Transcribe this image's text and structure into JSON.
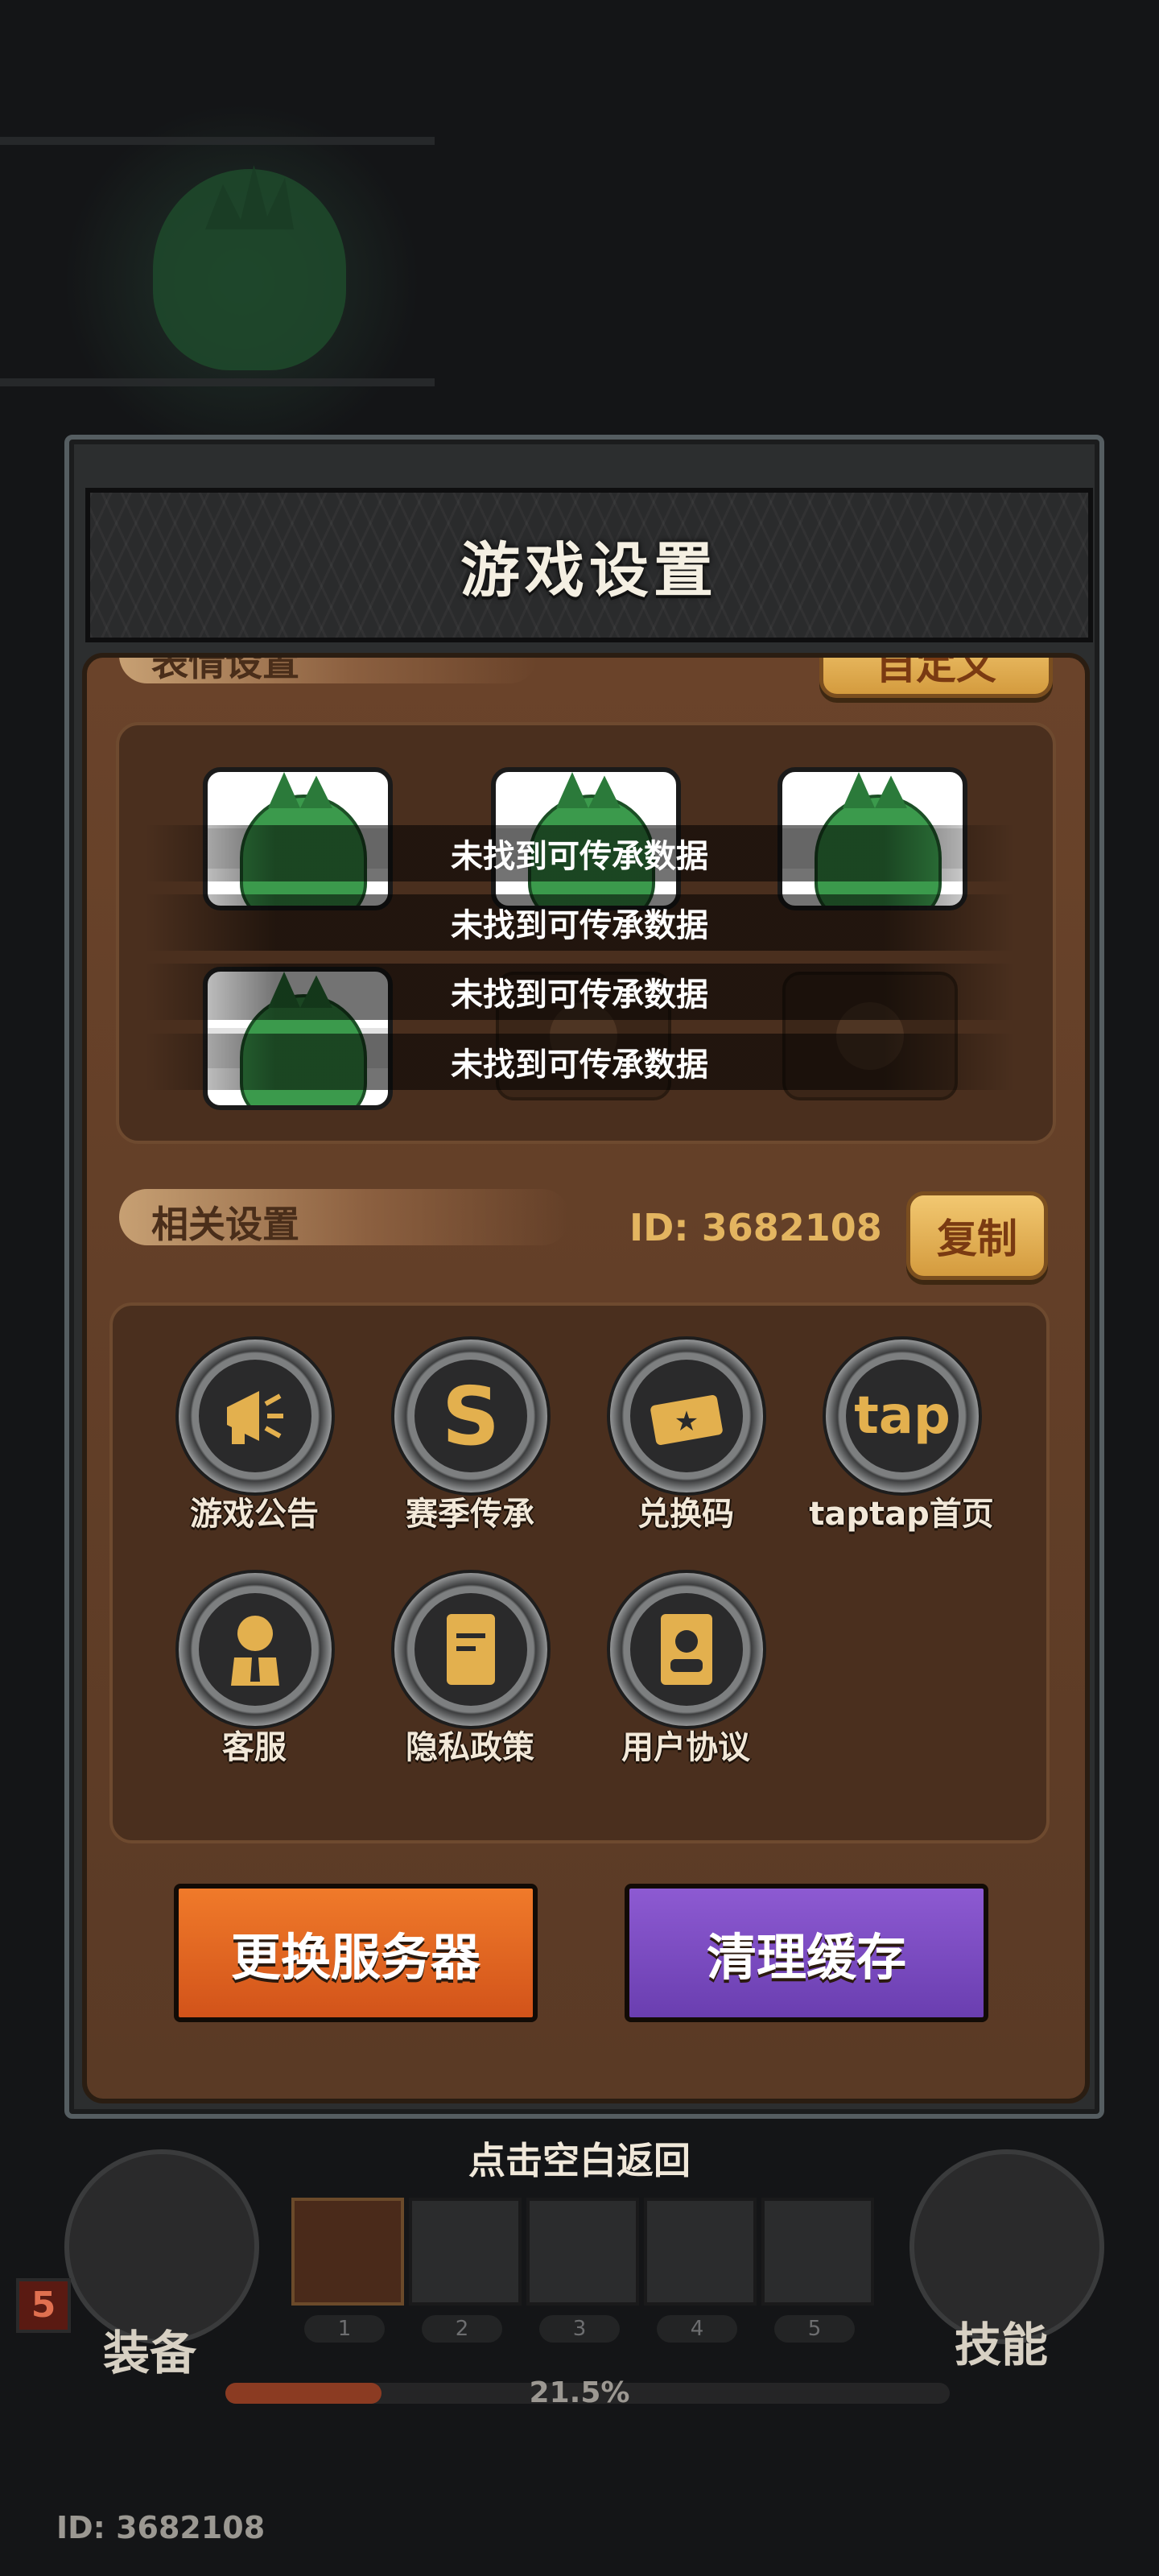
{
  "dialog": {
    "title": "游戏设置"
  },
  "expression_section": {
    "label": "表情设置",
    "custom_button": "自定义"
  },
  "toasts": [
    "未找到可传承数据",
    "未找到可传承数据",
    "未找到可传承数据",
    "未找到可传承数据"
  ],
  "related_section": {
    "label": "相关设置",
    "id_text": "ID: 3682108",
    "copy_button": "复制",
    "items": [
      {
        "label": "游戏公告",
        "icon": "megaphone-icon"
      },
      {
        "label": "赛季传承",
        "icon": "season-icon"
      },
      {
        "label": "兑换码",
        "icon": "ticket-icon"
      },
      {
        "label": "taptap首页",
        "icon": "taptap-icon",
        "glyph": "tap"
      },
      {
        "label": "客服",
        "icon": "customer-service-icon"
      },
      {
        "label": "隐私政策",
        "icon": "document-icon"
      },
      {
        "label": "用户协议",
        "icon": "id-card-icon"
      }
    ]
  },
  "buttons": {
    "change_server": "更换服务器",
    "clear_cache": "清理缓存"
  },
  "hud": {
    "hint": "点击空白返回",
    "level_badge": "5",
    "equipment_label": "装备",
    "skill_label": "技能",
    "slot_numbers": [
      "1",
      "2",
      "3",
      "4",
      "5"
    ],
    "progress_text": "21.5%",
    "progress_value": 0.215,
    "bottom_id": "ID: 3682108"
  },
  "colors": {
    "change_server_bg": "#e8681e",
    "clear_cache_bg": "#7a4cc0",
    "gold": "#e3b560"
  }
}
